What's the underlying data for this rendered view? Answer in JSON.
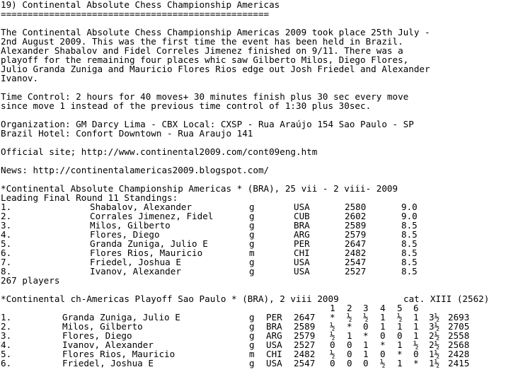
{
  "heading": "19) Continental Absolute Chess Championship Americas",
  "underline": "==================================================",
  "intro": [
    "The Continental Absolute Chess Championship Americas 2009 took place 25th July -",
    "2nd August 2009. This was the first time the event has been held in Brazil.",
    "Alexander Shabalov and Fidel Correles Jimenez finished on 9/11. There was a",
    "playoff for the remaining four places whic saw Gilberto Milos, Diego Flores,",
    "Julio Granda Zuniga and Mauricio Flores Rios edge out Josh Friedel and Alexander",
    "Ivanov."
  ],
  "time_control": [
    "Time Control: 2 hours for 40 moves+ 30 minutes finish plus 30 sec every move",
    "since move 1 instead of the previous time control of 1:30 plus 30sec."
  ],
  "organization": [
    "Organization: GM Darcy Lima - CBX Local: CXSP - Rua Araújo 154 Sao Paulo - SP",
    "Brazil Hotel: Confort Downtown - Rua Araujo 141"
  ],
  "official_site": "Official site; http://www.continental2009.com/cont09eng.htm",
  "news": "News: http://continentalamericas2009.blogspot.com/",
  "standings": {
    "title": "*Continental Absolute Championship Americas * (BRA), 25 vii - 2 viii- 2009",
    "subtitle": "Leading Final Round 11 Standings:",
    "rows": [
      {
        "rank": "1.",
        "name": "Shabalov, Alexander",
        "title": "g",
        "fed": "USA",
        "rating": "2580",
        "score": "9.0"
      },
      {
        "rank": "2.",
        "name": "Corrales Jimenez, Fidel",
        "title": "g",
        "fed": "CUB",
        "rating": "2602",
        "score": "9.0"
      },
      {
        "rank": "3.",
        "name": "Milos, Gilberto",
        "title": "g",
        "fed": "BRA",
        "rating": "2589",
        "score": "8.5"
      },
      {
        "rank": "4.",
        "name": "Flores, Diego",
        "title": "g",
        "fed": "ARG",
        "rating": "2579",
        "score": "8.5"
      },
      {
        "rank": "5.",
        "name": "Granda Zuniga, Julio E",
        "title": "g",
        "fed": "PER",
        "rating": "2647",
        "score": "8.5"
      },
      {
        "rank": "6.",
        "name": "Flores Rios, Mauricio",
        "title": "m",
        "fed": "CHI",
        "rating": "2482",
        "score": "8.5"
      },
      {
        "rank": "7.",
        "name": "Friedel, Joshua E",
        "title": "g",
        "fed": "USA",
        "rating": "2547",
        "score": "8.5"
      },
      {
        "rank": "8.",
        "name": "Ivanov, Alexander",
        "title": "g",
        "fed": "USA",
        "rating": "2527",
        "score": "8.5"
      }
    ],
    "players": "267 players"
  },
  "playoff": {
    "title": "*Continental ch-Americas Playoff Sao Paulo * (BRA), 2 viii 2009",
    "category": "cat. XIII (2562)",
    "round_numbers": [
      "1",
      "2",
      "3",
      "4",
      "5",
      "6"
    ],
    "rows": [
      {
        "rank": "1.",
        "name": "Granda Zuniga, Julio E",
        "title": "g",
        "fed": "PER",
        "rating": "2647",
        "results": [
          "*",
          "½",
          "½",
          "1",
          "½",
          "1"
        ],
        "total": "3½",
        "perf": "2693"
      },
      {
        "rank": "2.",
        "name": "Milos, Gilberto",
        "title": "g",
        "fed": "BRA",
        "rating": "2589",
        "results": [
          "½",
          "*",
          "0",
          "1",
          "1",
          "1"
        ],
        "total": "3½",
        "perf": "2705"
      },
      {
        "rank": "3.",
        "name": "Flores, Diego",
        "title": "g",
        "fed": "ARG",
        "rating": "2579",
        "results": [
          "½",
          "1",
          "*",
          "0",
          "0",
          "1"
        ],
        "total": "2½",
        "perf": "2558"
      },
      {
        "rank": "4.",
        "name": "Ivanov, Alexander",
        "title": "g",
        "fed": "USA",
        "rating": "2527",
        "results": [
          "0",
          "0",
          "1",
          "*",
          "1",
          "½"
        ],
        "total": "2½",
        "perf": "2568"
      },
      {
        "rank": "5.",
        "name": "Flores Rios, Mauricio",
        "title": "m",
        "fed": "CHI",
        "rating": "2482",
        "results": [
          "½",
          "0",
          "1",
          "0",
          "*",
          "0"
        ],
        "total": "1½",
        "perf": "2428"
      },
      {
        "rank": "6.",
        "name": "Friedel, Joshua E",
        "title": "g",
        "fed": "USA",
        "rating": "2547",
        "results": [
          "0",
          "0",
          "0",
          "½",
          "1",
          "*"
        ],
        "total": "1½",
        "perf": "2415"
      }
    ]
  }
}
